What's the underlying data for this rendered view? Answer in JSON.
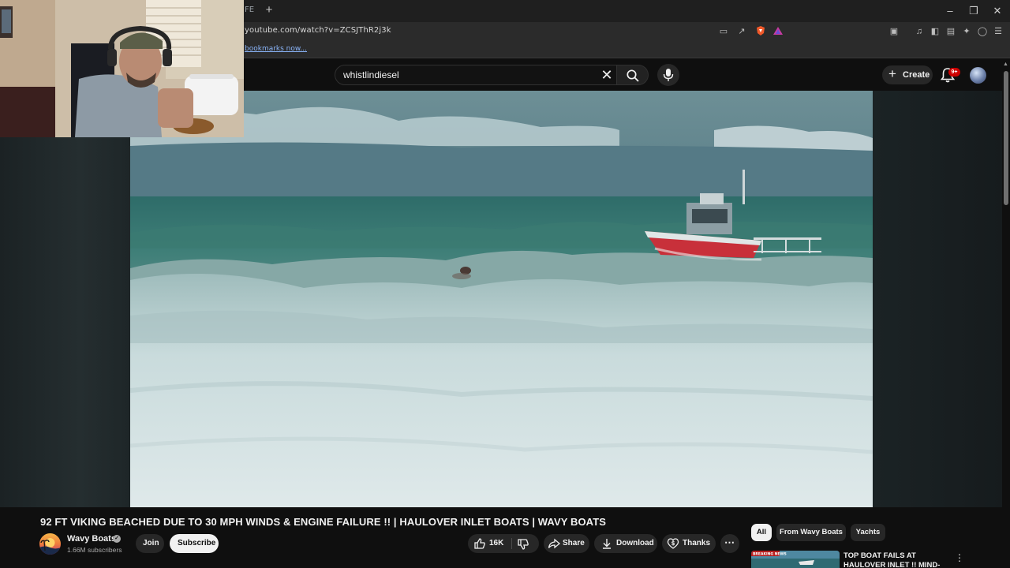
{
  "browser": {
    "tab_fragment": "FE",
    "new_tab_symbol": "+",
    "url": "youtube.com/watch?v=ZCSJThR2j3k",
    "bookmark_text": "bookmarks now...",
    "window_controls": [
      "minimize-icon",
      "restore-icon",
      "close-icon"
    ],
    "toolbar_icons": [
      "cast-icon",
      "share-icon",
      "brave-shield-icon",
      "brave-rewards-icon",
      "screenshot-icon",
      "media-icon",
      "sidebar-icon",
      "wallet-icon",
      "leo-ai-icon",
      "vpn-icon",
      "menu-icon"
    ]
  },
  "header": {
    "search_value": "whistlindiesel",
    "create_label": "Create",
    "notification_badge": "9+"
  },
  "video": {
    "title": "92 FT VIKING BEACHED DUE TO 30 MPH WINDS & ENGINE FAILURE !! | HAULOVER INLET BOATS | WAVY BOATS"
  },
  "channel": {
    "name": "Wavy Boats",
    "subscribers": "1.66M subscribers",
    "join_label": "Join",
    "subscribe_label": "Subscribe"
  },
  "actions": {
    "likes": "16K",
    "share_label": "Share",
    "download_label": "Download",
    "thanks_label": "Thanks"
  },
  "chips": {
    "all": "All",
    "from_channel": "From Wavy Boats",
    "yachts": "Yachts"
  },
  "recommendation": {
    "title": "TOP BOAT FAILS AT HAULOVER INLET !! MIND-BLOWING",
    "thumb_badge": "BREAKING NEWS"
  },
  "colors": {
    "page_bg": "#0f0f0f",
    "chip_active": "#f1f1f1",
    "badge_red": "#cc0000",
    "boat_red": "#c8303a",
    "sea": "#3f7f78"
  }
}
